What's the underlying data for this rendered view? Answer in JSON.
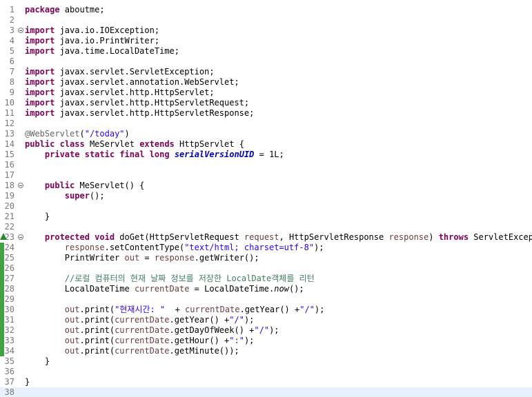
{
  "editor": {
    "lines": [
      {
        "num": "1",
        "tokens": [
          {
            "t": "package",
            "c": "kw"
          },
          {
            "t": " aboutme;"
          }
        ]
      },
      {
        "num": "2",
        "tokens": []
      },
      {
        "num": "3",
        "fold": true,
        "tokens": [
          {
            "t": "import",
            "c": "kw"
          },
          {
            "t": " java.io.IOException;"
          }
        ]
      },
      {
        "num": "4",
        "tokens": [
          {
            "t": "import",
            "c": "kw"
          },
          {
            "t": " java.io.PrintWriter;"
          }
        ]
      },
      {
        "num": "5",
        "tokens": [
          {
            "t": "import",
            "c": "kw"
          },
          {
            "t": " java.time.LocalDateTime;"
          }
        ]
      },
      {
        "num": "6",
        "tokens": []
      },
      {
        "num": "7",
        "tokens": [
          {
            "t": "import",
            "c": "kw"
          },
          {
            "t": " javax.servlet.ServletException;"
          }
        ]
      },
      {
        "num": "8",
        "tokens": [
          {
            "t": "import",
            "c": "kw"
          },
          {
            "t": " javax.servlet.annotation.WebServlet;"
          }
        ]
      },
      {
        "num": "9",
        "tokens": [
          {
            "t": "import",
            "c": "kw"
          },
          {
            "t": " javax.servlet.http.HttpServlet;"
          }
        ]
      },
      {
        "num": "10",
        "tokens": [
          {
            "t": "import",
            "c": "kw"
          },
          {
            "t": " javax.servlet.http.HttpServletRequest;"
          }
        ]
      },
      {
        "num": "11",
        "tokens": [
          {
            "t": "import",
            "c": "kw"
          },
          {
            "t": " javax.servlet.http.HttpServletResponse;"
          }
        ]
      },
      {
        "num": "12",
        "tokens": []
      },
      {
        "num": "13",
        "tokens": [
          {
            "t": "@WebServlet",
            "c": "ann"
          },
          {
            "t": "("
          },
          {
            "t": "\"/today\"",
            "c": "str"
          },
          {
            "t": ")"
          }
        ]
      },
      {
        "num": "14",
        "tokens": [
          {
            "t": "public",
            "c": "kw"
          },
          {
            "t": " "
          },
          {
            "t": "class",
            "c": "kw"
          },
          {
            "t": " MeServlet "
          },
          {
            "t": "extends",
            "c": "kw"
          },
          {
            "t": " HttpServlet {"
          }
        ]
      },
      {
        "num": "15",
        "tokens": [
          {
            "t": "    "
          },
          {
            "t": "private",
            "c": "kw"
          },
          {
            "t": " "
          },
          {
            "t": "static",
            "c": "kw"
          },
          {
            "t": " "
          },
          {
            "t": "final",
            "c": "kw"
          },
          {
            "t": " "
          },
          {
            "t": "long",
            "c": "kw"
          },
          {
            "t": " "
          },
          {
            "t": "serialVersionUID",
            "c": "sfld"
          },
          {
            "t": " = 1L;"
          }
        ]
      },
      {
        "num": "16",
        "tokens": []
      },
      {
        "num": "17",
        "tokens": []
      },
      {
        "num": "18",
        "fold": true,
        "tokens": [
          {
            "t": "    "
          },
          {
            "t": "public",
            "c": "kw"
          },
          {
            "t": " MeServlet() {"
          }
        ]
      },
      {
        "num": "19",
        "tokens": [
          {
            "t": "        "
          },
          {
            "t": "super",
            "c": "kw"
          },
          {
            "t": "();"
          }
        ]
      },
      {
        "num": "20",
        "tokens": []
      },
      {
        "num": "21",
        "tokens": [
          {
            "t": "    }"
          }
        ]
      },
      {
        "num": "22",
        "tokens": []
      },
      {
        "num": "23",
        "fold": true,
        "marker": true,
        "tokens": [
          {
            "t": "    "
          },
          {
            "t": "protected",
            "c": "kw"
          },
          {
            "t": " "
          },
          {
            "t": "void",
            "c": "kw"
          },
          {
            "t": " doGet(HttpServletRequest "
          },
          {
            "t": "request",
            "c": "param"
          },
          {
            "t": ", HttpServletResponse "
          },
          {
            "t": "response",
            "c": "param"
          },
          {
            "t": ") "
          },
          {
            "t": "throws",
            "c": "kw"
          },
          {
            "t": " ServletException"
          }
        ]
      },
      {
        "num": "24",
        "bar": true,
        "tokens": [
          {
            "t": "        "
          },
          {
            "t": "response",
            "c": "param"
          },
          {
            "t": ".setContentType("
          },
          {
            "t": "\"text/html; charset=utf-8\"",
            "c": "str"
          },
          {
            "t": ");"
          }
        ]
      },
      {
        "num": "25",
        "bar": true,
        "tokens": [
          {
            "t": "        PrintWriter "
          },
          {
            "t": "out",
            "c": "var"
          },
          {
            "t": " = "
          },
          {
            "t": "response",
            "c": "param"
          },
          {
            "t": ".getWriter();"
          }
        ]
      },
      {
        "num": "26",
        "bar": true,
        "tokens": []
      },
      {
        "num": "27",
        "bar": true,
        "tokens": [
          {
            "t": "        "
          },
          {
            "t": "//로컬 컴퓨터의 현재 날짜 정보를 저장한 LocalDate객체를 리턴",
            "c": "cmt"
          }
        ]
      },
      {
        "num": "28",
        "bar": true,
        "tokens": [
          {
            "t": "        LocalDateTime "
          },
          {
            "t": "currentDate",
            "c": "var"
          },
          {
            "t": " = LocalDateTime."
          },
          {
            "t": "now",
            "c": "smeth"
          },
          {
            "t": "();"
          }
        ]
      },
      {
        "num": "29",
        "bar": true,
        "tokens": []
      },
      {
        "num": "30",
        "bar": true,
        "tokens": [
          {
            "t": "        "
          },
          {
            "t": "out",
            "c": "var"
          },
          {
            "t": ".print("
          },
          {
            "t": "\"현재시간: \"",
            "c": "str"
          },
          {
            "t": "  + "
          },
          {
            "t": "currentDate",
            "c": "var"
          },
          {
            "t": ".getYear() +"
          },
          {
            "t": "\"/\"",
            "c": "str"
          },
          {
            "t": ");"
          }
        ]
      },
      {
        "num": "31",
        "bar": true,
        "tokens": [
          {
            "t": "        "
          },
          {
            "t": "out",
            "c": "var"
          },
          {
            "t": ".print("
          },
          {
            "t": "currentDate",
            "c": "var"
          },
          {
            "t": ".getYear() +"
          },
          {
            "t": "\"/\"",
            "c": "str"
          },
          {
            "t": ");"
          }
        ]
      },
      {
        "num": "32",
        "bar": true,
        "tokens": [
          {
            "t": "        "
          },
          {
            "t": "out",
            "c": "var"
          },
          {
            "t": ".print("
          },
          {
            "t": "currentDate",
            "c": "var"
          },
          {
            "t": ".getDayOfWeek() +"
          },
          {
            "t": "\"/\"",
            "c": "str"
          },
          {
            "t": ");"
          }
        ]
      },
      {
        "num": "33",
        "bar": true,
        "tokens": [
          {
            "t": "        "
          },
          {
            "t": "out",
            "c": "var"
          },
          {
            "t": ".print("
          },
          {
            "t": "currentDate",
            "c": "var"
          },
          {
            "t": ".getHour() +"
          },
          {
            "t": "\":\"",
            "c": "str"
          },
          {
            "t": ");"
          }
        ]
      },
      {
        "num": "34",
        "bar": true,
        "tokens": [
          {
            "t": "        "
          },
          {
            "t": "out",
            "c": "var"
          },
          {
            "t": ".print("
          },
          {
            "t": "currentDate",
            "c": "var"
          },
          {
            "t": ".getMinute());"
          }
        ]
      },
      {
        "num": "35",
        "tokens": [
          {
            "t": "    }"
          }
        ]
      },
      {
        "num": "36",
        "tokens": []
      },
      {
        "num": "37",
        "tokens": [
          {
            "t": "}"
          }
        ]
      },
      {
        "num": "38",
        "current": true,
        "tokens": []
      }
    ]
  },
  "colors": {
    "keyword": "#7f0055",
    "string": "#2a00ff",
    "comment": "#3f7f5f",
    "annotation": "#646464",
    "static_field": "#0000c0",
    "local_variable": "#6a3e3e",
    "current_line": "#e8f2fe",
    "override_marker": "#2a8b2a"
  },
  "icons": {
    "fold": "fold-collapse-icon",
    "override": "override-triangle-icon"
  }
}
